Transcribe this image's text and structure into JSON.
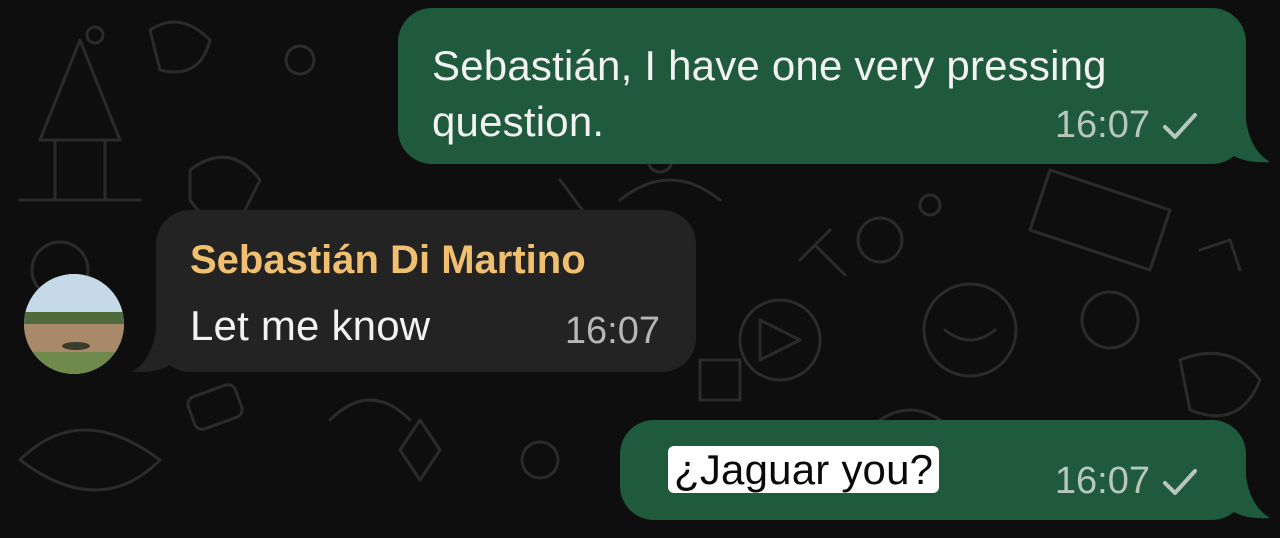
{
  "messages": [
    {
      "direction": "outgoing",
      "text_line1": "Sebastián, I have one very pressing",
      "text_line2": "question.",
      "time": "16:07",
      "status_icon": "check-icon"
    },
    {
      "direction": "incoming",
      "sender": "Sebastián Di Martino",
      "text": "Let me know",
      "time": "16:07"
    },
    {
      "direction": "outgoing",
      "text": "¿Jaguar you?",
      "time": "16:07",
      "status_icon": "check-icon"
    }
  ],
  "colors": {
    "background": "#0e0e0f",
    "outgoing_bubble": "#1f5a3c",
    "incoming_bubble": "#232324",
    "sender_name": "#f0c070"
  }
}
